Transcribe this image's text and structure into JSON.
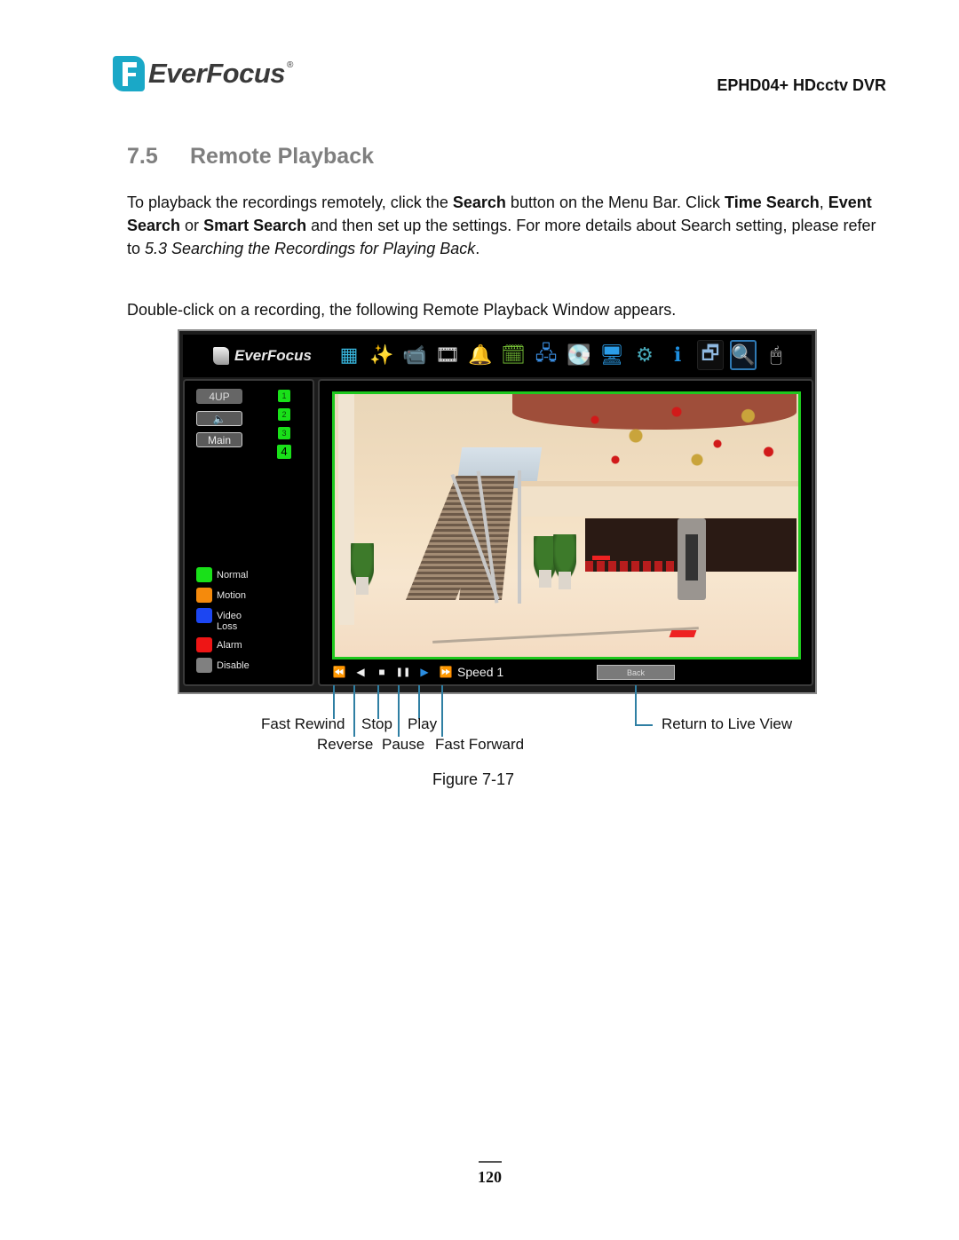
{
  "header": {
    "brand": "EverFocus",
    "brand_mark": "®",
    "model": "EPHD04+  HDcctv DVR"
  },
  "section": {
    "number": "7.5",
    "title": "Remote Playback"
  },
  "body": {
    "p1": {
      "t1": "To playback the recordings remotely, click the ",
      "b1": "Search",
      "t2": " button on the Menu Bar. Click ",
      "b2": "Time Search",
      "t3": ", ",
      "b3": "Event Search",
      "t4": " or ",
      "b4": "Smart Search",
      "t5": " and then set up the settings. For more details about Search setting, please refer to ",
      "i1": "5.3 Searching the Recordings for Playing Back",
      "t6": "."
    },
    "p2": "Double-click on a recording, the following Remote Playback Window appears."
  },
  "dvr": {
    "logo": "EverFocus",
    "toolbar": [
      {
        "icon": "monitor-grid-icon",
        "glyph": "▦"
      },
      {
        "icon": "magic-wand-icon",
        "glyph": "✨"
      },
      {
        "icon": "camera-icon",
        "glyph": "📹"
      },
      {
        "icon": "film-reel-icon",
        "glyph": "🎞"
      },
      {
        "icon": "bell-icon",
        "glyph": "🔔"
      },
      {
        "icon": "schedule-clock-icon",
        "glyph": "🗓"
      },
      {
        "icon": "network-icon",
        "glyph": "🖧"
      },
      {
        "icon": "hard-disk-icon",
        "glyph": "💽"
      },
      {
        "icon": "display-icon",
        "glyph": "🖥"
      },
      {
        "icon": "settings-gears-icon",
        "glyph": "⚙"
      },
      {
        "icon": "info-icon",
        "glyph": "ℹ"
      },
      {
        "icon": "playback-windows-icon",
        "glyph": "🗗"
      },
      {
        "icon": "search-icon",
        "glyph": "🔍"
      },
      {
        "icon": "mouse-icon",
        "glyph": "🖱"
      }
    ],
    "left": {
      "btn_4up": "4UP",
      "btn_audio_glyph": "🔈",
      "btn_main": "Main",
      "channels": [
        "1",
        "2",
        "3",
        "4"
      ],
      "legend": [
        {
          "label": "Normal",
          "color": "#19e019"
        },
        {
          "label": "Motion",
          "color": "#f58a0c"
        },
        {
          "label": "Video Loss",
          "color": "#1c46f2"
        },
        {
          "label": "Alarm",
          "color": "#ee1515"
        },
        {
          "label": "Disable",
          "color": "#808080"
        }
      ]
    },
    "controls": {
      "fast_rewind": "⏪",
      "reverse": "◀",
      "stop": "■",
      "pause": "❚❚",
      "play": "▶",
      "fast_forward": "⏩",
      "speed": "Speed 1",
      "back": "Back"
    }
  },
  "callouts": {
    "fast_rewind": "Fast Rewind",
    "reverse": "Reverse",
    "stop": "Stop",
    "pause": "Pause",
    "play": "Play",
    "fast_forward": "Fast Forward",
    "return_live": "Return to Live View"
  },
  "figure_caption": "Figure 7-17",
  "page_number": "120"
}
